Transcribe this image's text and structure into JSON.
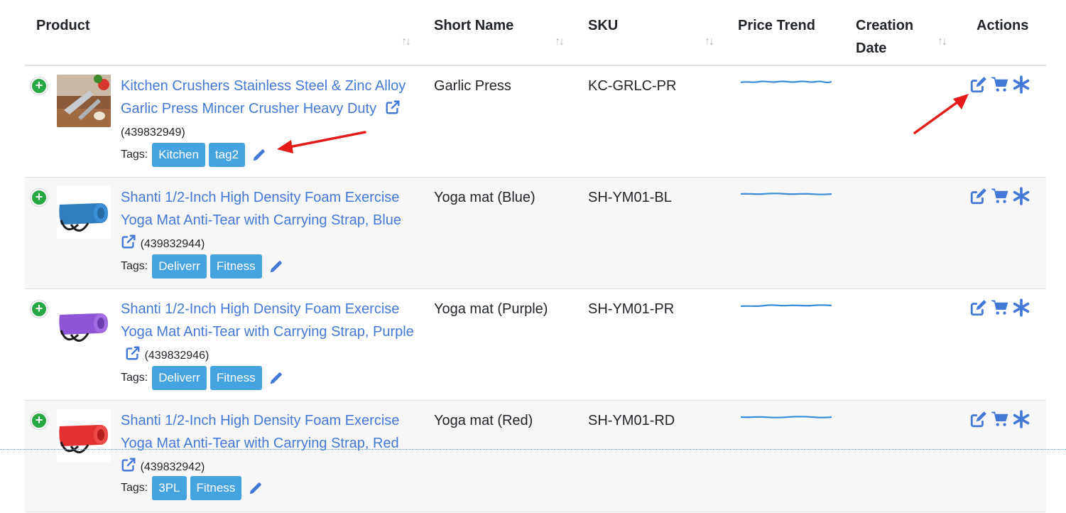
{
  "header": {
    "product": "Product",
    "short_name": "Short Name",
    "sku": "SKU",
    "price_trend": "Price Trend",
    "creation_date": "Creation Date",
    "actions": "Actions",
    "sort_glyph": "↑↓"
  },
  "colors": {
    "link": "#4478d6",
    "tag_bg": "#45a3e0",
    "expand_green": "#28a745",
    "trend_line": "#3a8dd8",
    "annotation_red": "#e41b17"
  },
  "rows": [
    {
      "title": "Kitchen Crushers Stainless Steel & Zinc Alloy Garlic Press Mincer Crusher Heavy Duty",
      "id": "(439832949)",
      "tags_label": "Tags:",
      "tags": [
        "Kitchen",
        "tag2"
      ],
      "short_name": "Garlic Press",
      "sku": "KC-GRLC-PR",
      "thumb": "garlic-press-image"
    },
    {
      "title": "Shanti 1/2-Inch High Density Foam Exercise Yoga Mat Anti-Tear with Carrying Strap, Blue",
      "id": "(439832944)",
      "tags_label": "Tags:",
      "tags": [
        "Deliverr",
        "Fitness"
      ],
      "short_name": "Yoga mat (Blue)",
      "sku": "SH-YM01-BL",
      "thumb": "yoga-mat-blue-image"
    },
    {
      "title": "Shanti 1/2-Inch High Density Foam Exercise Yoga Mat Anti-Tear with Carrying Strap, Purple",
      "id": "(439832946)",
      "tags_label": "Tags:",
      "tags": [
        "Deliverr",
        "Fitness"
      ],
      "short_name": "Yoga mat (Purple)",
      "sku": "SH-YM01-PR",
      "thumb": "yoga-mat-purple-image"
    },
    {
      "title": "Shanti 1/2-Inch High Density Foam Exercise Yoga Mat Anti-Tear with Carrying Strap, Red",
      "id": "(439832942)",
      "tags_label": "Tags:",
      "tags": [
        "3PL",
        "Fitness"
      ],
      "short_name": "Yoga mat (Red)",
      "sku": "SH-YM01-RD",
      "thumb": "yoga-mat-red-image"
    }
  ]
}
